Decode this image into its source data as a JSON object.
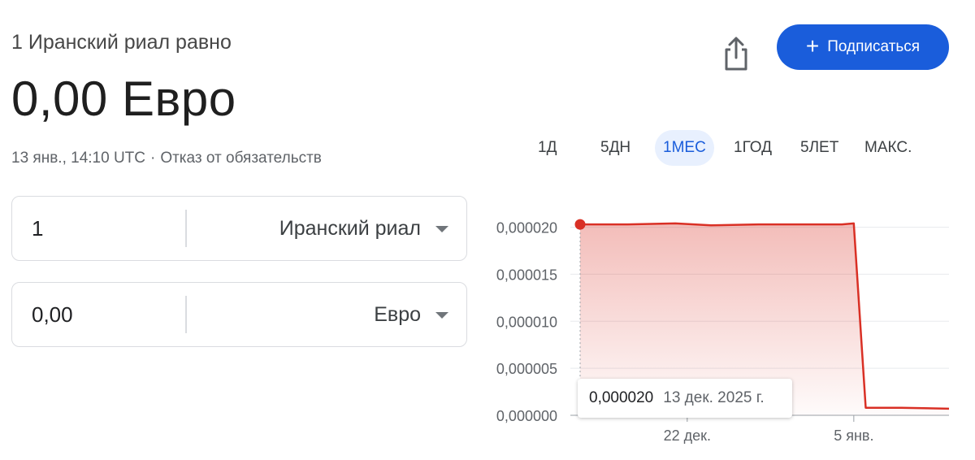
{
  "header": {
    "rate_label": "1 Иранский риал равно",
    "rate_value": "0,00 Евро",
    "timestamp": "13 янв., 14:10 UTC",
    "disclaimer": "Отказ от обязательств",
    "subscribe_label": "Подписаться",
    "subscribe_icon": "plus-icon",
    "share_icon": "share-icon",
    "accent_color": "#1a5ddb"
  },
  "converter": {
    "from": {
      "amount": "1",
      "currency": "Иранский риал"
    },
    "to": {
      "amount": "0,00",
      "currency": "Евро"
    }
  },
  "range_tabs": [
    {
      "label": "1Д",
      "active": false
    },
    {
      "label": "5ДН",
      "active": false
    },
    {
      "label": "1МЕС",
      "active": true
    },
    {
      "label": "1ГОД",
      "active": false
    },
    {
      "label": "5ЛЕТ",
      "active": false
    },
    {
      "label": "МАКС.",
      "active": false
    }
  ],
  "tooltip": {
    "value": "0,000020",
    "date": "13 дек. 2025 г."
  },
  "chart_data": {
    "type": "area",
    "line_color": "#d93025",
    "y_ticks": [
      "0,000020",
      "0,000015",
      "0,000010",
      "0,000005",
      "0,000000"
    ],
    "y_tick_values": [
      2e-05,
      1.5e-05,
      1e-05,
      5e-06,
      0
    ],
    "ylim": [
      0,
      2.1e-05
    ],
    "x_tick_labels": [
      {
        "label": "22 дек.",
        "date": "2025-12-22"
      },
      {
        "label": "5 янв.",
        "date": "2026-01-05"
      }
    ],
    "x_range": [
      "2025-12-13",
      "2026-01-13"
    ],
    "grid": true,
    "series": [
      {
        "points": [
          [
            "2025-12-13",
            2.03e-05
          ],
          [
            "2025-12-17",
            2.03e-05
          ],
          [
            "2025-12-21",
            2.04e-05
          ],
          [
            "2025-12-24",
            2.02e-05
          ],
          [
            "2025-12-28",
            2.03e-05
          ],
          [
            "2026-01-01",
            2.03e-05
          ],
          [
            "2026-01-04",
            2.03e-05
          ],
          [
            "2026-01-05",
            2.04e-05
          ],
          [
            "2026-01-06",
            8e-07
          ],
          [
            "2026-01-09",
            8e-07
          ],
          [
            "2026-01-13",
            7e-07
          ]
        ]
      }
    ],
    "highlight_point": [
      "2025-12-13",
      2.03e-05
    ]
  }
}
